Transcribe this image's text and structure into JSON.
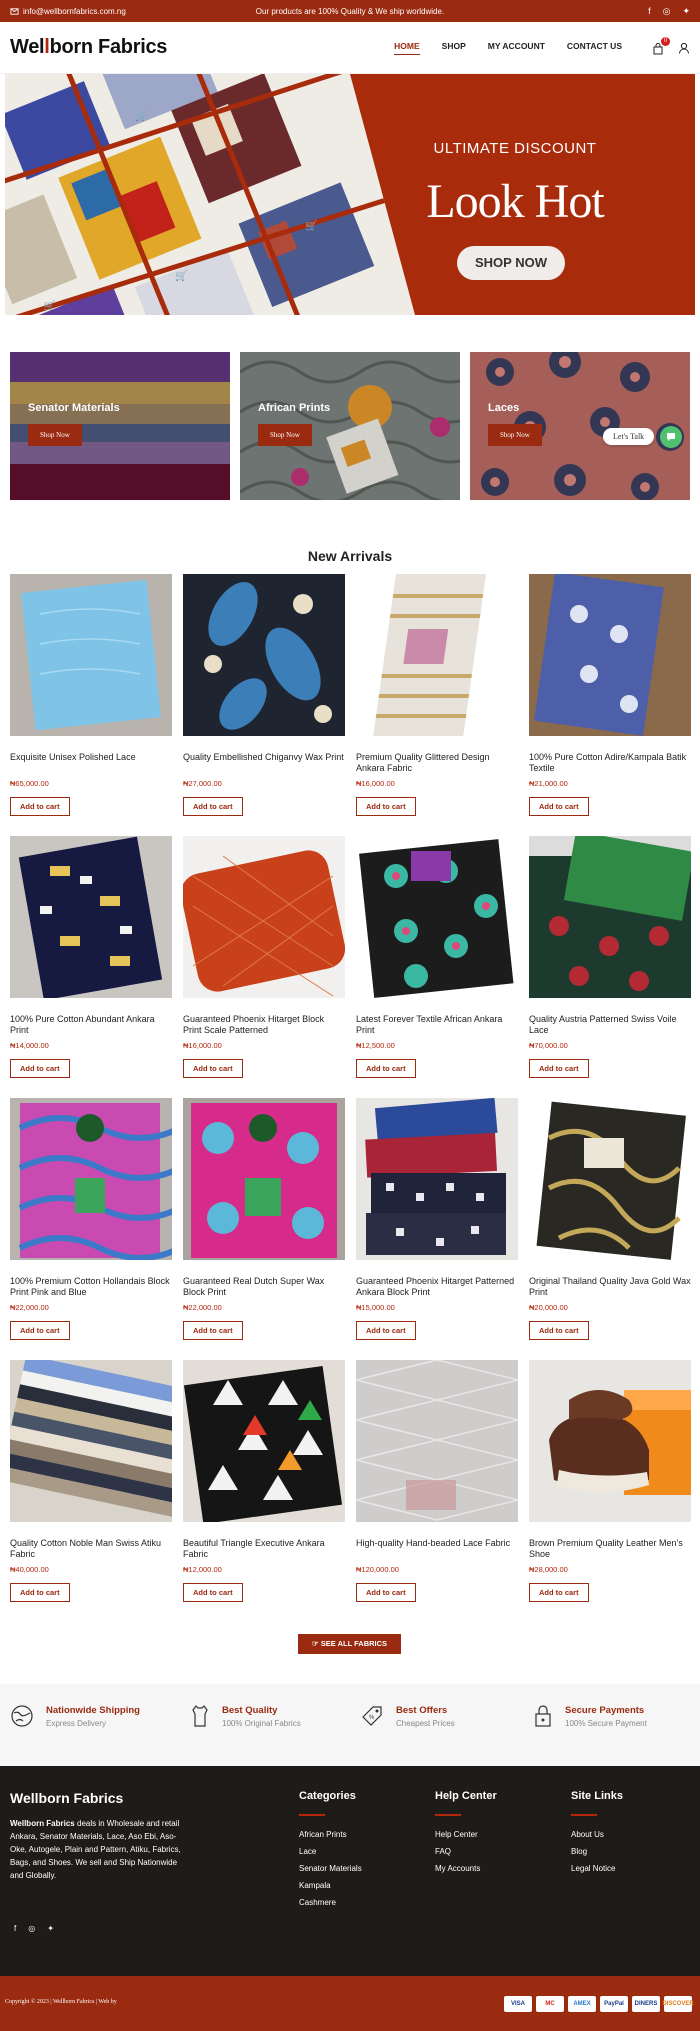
{
  "topbar": {
    "email": "info@wellbornfabrics.com.ng",
    "message": "Our products are 100% Quality & We ship worldwide.",
    "socials": [
      "facebook-icon",
      "instagram-icon",
      "twitter-icon"
    ]
  },
  "header": {
    "logo_pre": "Wel",
    "logo_mid": "l",
    "logo_post": "born Fabrics",
    "nav": [
      {
        "label": "HOME",
        "active": true
      },
      {
        "label": "SHOP"
      },
      {
        "label": "MY ACCOUNT"
      },
      {
        "label": "CONTACT US"
      }
    ],
    "cart_count": "0"
  },
  "hero": {
    "subheading": "ULTIMATE DISCOUNT",
    "heading": "Look Hot",
    "button": "SHOP NOW"
  },
  "categories": [
    {
      "label": "Senator Materials",
      "button": "Shop Now"
    },
    {
      "label": "African Prints",
      "button": "Shop Now"
    },
    {
      "label": "Laces",
      "button": "Shop Now"
    }
  ],
  "chat": {
    "label": "Let's Talk"
  },
  "new_arrivals": {
    "title": "New Arrivals",
    "add_label": "Add to cart",
    "products": [
      {
        "name": "Exquisite Unisex Polished Lace",
        "price": "₦65,000.00"
      },
      {
        "name": "Quality Embellished Chiganvy Wax Print",
        "price": "₦27,000.00"
      },
      {
        "name": "Premium Quality Glittered Design Ankara Fabric",
        "price": "₦16,000.00"
      },
      {
        "name": "100% Pure Cotton Adire/Kampala Batik Textile",
        "price": "₦21,000.00"
      },
      {
        "name": "100% Pure Cotton Abundant Ankara Print",
        "price": "₦14,000.00"
      },
      {
        "name": "Guaranteed Phoenix Hitarget Block Print Scale Patterned",
        "price": "₦16,000.00"
      },
      {
        "name": "Latest Forever Textile African Ankara Print",
        "price": "₦12,500.00"
      },
      {
        "name": "Quality Austria Patterned Swiss Voile Lace",
        "price": "₦70,000.00"
      },
      {
        "name": "100% Premium Cotton Hollandais Block Print Pink and Blue",
        "price": "₦22,000.00"
      },
      {
        "name": "Guaranteed Real Dutch Super Wax Block Print",
        "price": "₦22,000.00"
      },
      {
        "name": "Guaranteed Phoenix Hitarget Patterned Ankara Block Print",
        "price": "₦15,000.00"
      },
      {
        "name": "Original Thailand Quality Java Gold Wax Print",
        "price": "₦20,000.00"
      },
      {
        "name": "Quality Cotton Noble Man Swiss Atiku Fabric",
        "price": "₦40,000.00"
      },
      {
        "name": "Beautiful Triangle Executive Ankara Fabric",
        "price": "₦12,000.00"
      },
      {
        "name": "High-quality Hand-beaded Lace Fabric",
        "price": "₦120,000.00"
      },
      {
        "name": "Brown Premium Quality Leather Men's Shoe",
        "price": "₦28,000.00"
      }
    ],
    "see_all": "SEE ALL FABRICS"
  },
  "features": [
    {
      "title": "Nationwide Shipping",
      "subtitle": "Express Delivery",
      "icon": "globe-icon"
    },
    {
      "title": "Best Quality",
      "subtitle": "100% Original Fabrics",
      "icon": "shirt-icon"
    },
    {
      "title": "Best Offers",
      "subtitle": "Cheapest Prices",
      "icon": "tag-icon"
    },
    {
      "title": "Secure Payments",
      "subtitle": "100% Secure Payment",
      "icon": "lock-icon"
    }
  ],
  "footer": {
    "brand": "Wellborn Fabrics",
    "about_bold": "Wellborn Fabrics",
    "about_text": " deals in Wholesale and retail Ankara, Senator Materials, Lace, Aso Ebi, Aso-Oke, Autogele, Plain and Pattern, Atiku, Fabrics, Bags, and Shoes. We sell and Ship Nationwide and Globally.",
    "categories": {
      "title": "Categories",
      "items": [
        "African Prints",
        "Lace",
        "Senator Materials",
        "Kampala",
        "Cashmere"
      ]
    },
    "help": {
      "title": "Help Center",
      "items": [
        "Help Center",
        "FAQ",
        "My Accounts"
      ]
    },
    "links": {
      "title": "Site Links",
      "items": [
        "About Us",
        "Blog",
        "Legal Notice"
      ]
    },
    "copyright": "Copyright © 2023 | Wellborn Fabrics | Web by ",
    "payments": [
      "VISA",
      "MC",
      "AMEX",
      "PayPal",
      "DINERS",
      "DISCOVER"
    ]
  }
}
